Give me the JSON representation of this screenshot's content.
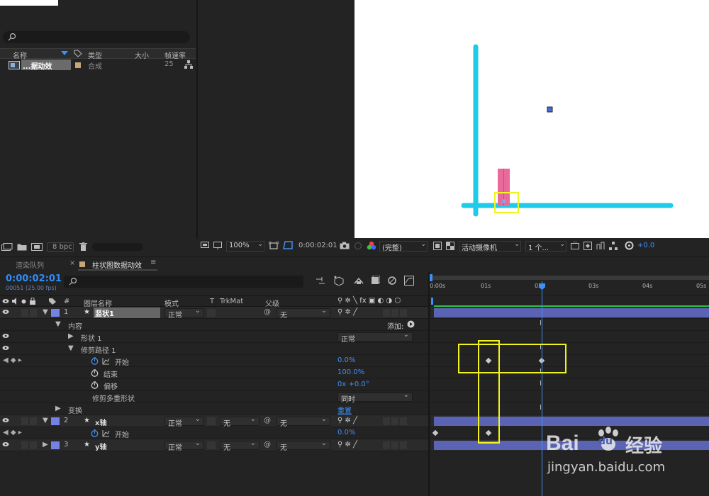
{
  "project": {
    "search_placeholder": "",
    "columns": {
      "name": "名称",
      "type": "类型",
      "size": "大小",
      "fps": "帧速率"
    },
    "item": {
      "name": "...据动效",
      "type": "合成",
      "fps": "25"
    },
    "bpc": "8 bpc"
  },
  "viewer": {
    "zoom": "100%",
    "timecode": "0:00:02:01",
    "quality": "(完整)",
    "camera": "活动摄像机",
    "views": "1 个...",
    "exposure": "+0.0"
  },
  "timeline": {
    "tabs": {
      "render_queue": "渲染队列",
      "comp_name": "柱状图数据动效"
    },
    "current_time": "0:00:02:01",
    "fps_info": "00051 (25.00 fps)",
    "headers": {
      "num": "#",
      "layer_name": "图层名称",
      "mode": "模式",
      "t": "T",
      "trkmat": "TrkMat",
      "parent": "父级"
    },
    "ruler": [
      "0:00s",
      "01s",
      "02s",
      "03s",
      "04s",
      "05s"
    ],
    "add_label": "添加:",
    "rows": {
      "l1_num": "1",
      "l1_name": "竖状1",
      "l1_mode": "正常",
      "l1_parent": "无",
      "contents": "内容",
      "shape": "形状 1",
      "shape_mode": "正常",
      "trim": "修剪路径 1",
      "start": "开始",
      "start_val": "0.0%",
      "end": "结束",
      "end_val": "100.0%",
      "offset": "偏移",
      "offset_val": "0x +0.0°",
      "trim_multi": "修剪多重形状",
      "trim_multi_val": "同时",
      "transform": "变换",
      "reset": "重置",
      "l2_num": "2",
      "l2_name": "x轴",
      "l2_mode": "正常",
      "l2_trk": "无",
      "l2_parent": "无",
      "l2_start": "开始",
      "l2_start_val": "0.0%",
      "l3_num": "3",
      "l3_name": "y轴",
      "l3_mode": "正常",
      "l3_trk": "无",
      "l3_parent": "无"
    }
  },
  "watermark": {
    "brand": "Bai",
    "brand2": "du",
    "brand3": "经验",
    "url": "jingyan.baidu.com"
  },
  "colors": {
    "accent_blue": "#2f8ef5",
    "cyan_axis": "#1ecbe8",
    "bar_pink": "#e86a9b",
    "highlight": "#f3f31c",
    "layer_swatch": "#7382e3"
  }
}
